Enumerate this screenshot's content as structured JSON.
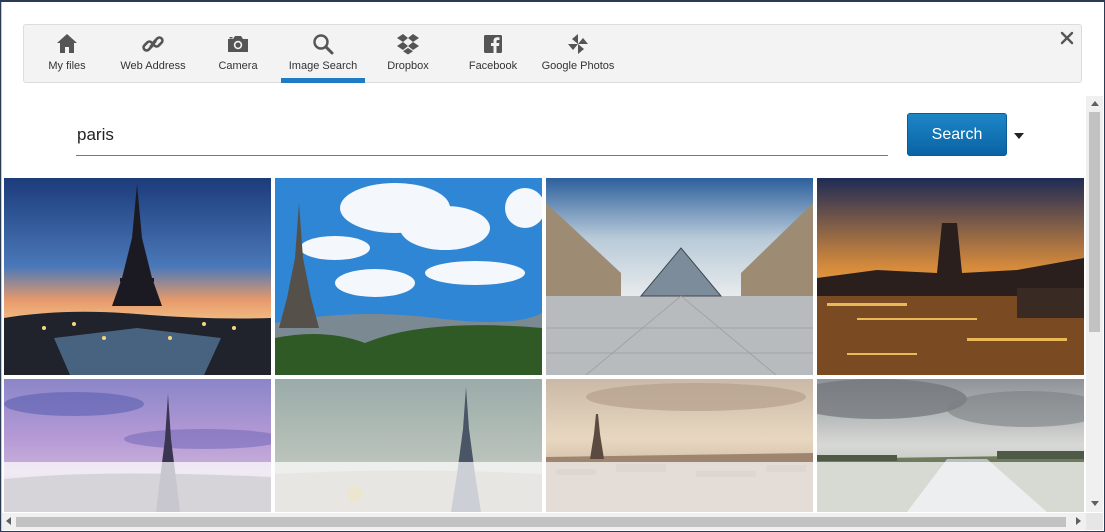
{
  "tabs": [
    {
      "label": "My files",
      "icon": "home-icon"
    },
    {
      "label": "Web Address",
      "icon": "link-icon"
    },
    {
      "label": "Camera",
      "icon": "camera-icon"
    },
    {
      "label": "Image Search",
      "icon": "search-icon",
      "active": true
    },
    {
      "label": "Dropbox",
      "icon": "dropbox-icon"
    },
    {
      "label": "Facebook",
      "icon": "facebook-icon"
    },
    {
      "label": "Google Photos",
      "icon": "pinwheel-icon"
    }
  ],
  "search": {
    "value": "paris",
    "button_label": "Search"
  },
  "results": [
    {
      "subject": "eiffel-tower-dusk"
    },
    {
      "subject": "eiffel-tower-clouds"
    },
    {
      "subject": "louvre-pyramid"
    },
    {
      "subject": "notre-dame-night"
    },
    {
      "subject": "eiffel-tower-purple-sky"
    },
    {
      "subject": "eiffel-tower-haze"
    },
    {
      "subject": "paris-skyline-sepia"
    },
    {
      "subject": "seine-cloudy"
    }
  ],
  "colors": {
    "accent": "#1f7cc4",
    "button": "#0f75b9",
    "underline": "#3d8f9e"
  }
}
